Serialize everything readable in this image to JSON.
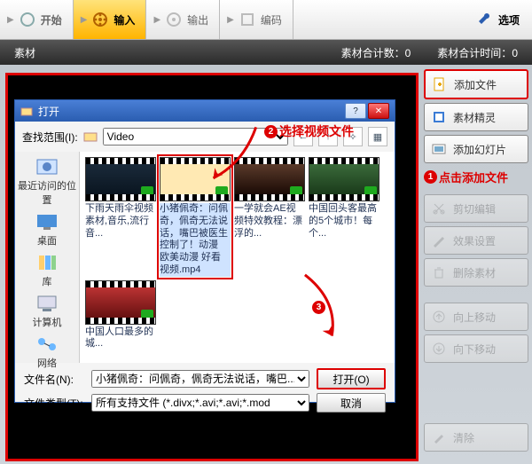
{
  "ribbon": {
    "tabs": [
      {
        "label": "开始",
        "active": false
      },
      {
        "label": "输入",
        "active": true
      },
      {
        "label": "输出",
        "active": false
      },
      {
        "label": "编码",
        "active": false
      }
    ],
    "options_label": "选项"
  },
  "bar": {
    "title": "素材",
    "count_label": "素材合计数：",
    "count_value": "0",
    "time_label": "素材合计时间：",
    "time_value": "0"
  },
  "side": {
    "add_file": "添加文件",
    "wizard": "素材精灵",
    "add_slide": "添加幻灯片",
    "cut": "剪切编辑",
    "effect": "效果设置",
    "delete": "删除素材",
    "move_up": "向上移动",
    "move_down": "向下移动",
    "clear": "清除"
  },
  "annot": {
    "step1": "点击添加文件",
    "step2": "选择视频文件"
  },
  "dialog": {
    "title": "打开",
    "lookin_label": "查找范围(I):",
    "lookin_value": "Video",
    "places": [
      "最近访问的位置",
      "桌面",
      "库",
      "计算机",
      "网络"
    ],
    "files": [
      {
        "caption": "下雨天雨伞视频素材,音乐,流行音..."
      },
      {
        "caption": "小猪佩奇：问佩奇，佩奇无法说话，嘴巴被医生控制了！动漫 欧美动漫 好看视频.mp4"
      },
      {
        "caption": "一学就会AE视频特效教程：漂浮的..."
      },
      {
        "caption": "中国回头客最高的5个城市！每个..."
      },
      {
        "caption": "中国人口最多的城..."
      }
    ],
    "selected_index": 1,
    "filename_label": "文件名(N):",
    "filename_value": "小猪佩奇：问佩奇，佩奇无法说话，嘴巴...",
    "filetype_label": "文件类型(T):",
    "filetype_value": "所有支持文件 (*.divx;*.avi;*.avi;*.mod",
    "open_btn": "打开(O)",
    "cancel_btn": "取消"
  }
}
